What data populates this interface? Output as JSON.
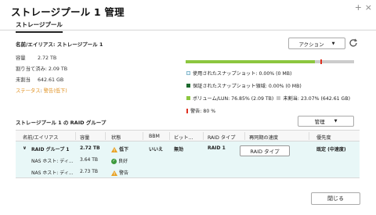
{
  "window": {
    "title": "ストレージプール 1 管理",
    "min_glyph": "+",
    "close_glyph": "×"
  },
  "tabs": [
    {
      "label": "ストレージプール"
    }
  ],
  "overview": {
    "name_line": "名前/エイリアス: ストレージプール 1",
    "rows": [
      {
        "label": "容量",
        "value": "2.72 TB"
      },
      {
        "label": "割り当て済み",
        "value": "2.09 TB"
      },
      {
        "label": "未割当",
        "value": "642.61 GB"
      },
      {
        "label": "ステータス",
        "value": "警告(低下)"
      }
    ],
    "status_color": "#e09020"
  },
  "actions": {
    "action_label": "アクション",
    "manage_label": "管理",
    "close_label": "閉じる",
    "raid_type_popup": "RAID タイプ"
  },
  "usage": {
    "used_fraction": 0.7685,
    "warn_fraction": 0.8,
    "legend": [
      {
        "key": "snapshot",
        "text": "使用されたスナップショット: 0.00% (0 MB)"
      },
      {
        "key": "reserved",
        "text": "保証されたスナップショット領域: 0.00% (0 MB)"
      },
      {
        "key": "volume",
        "text": "ボリューム/LUN: 76.85% (2.09 TB)"
      },
      {
        "key": "free",
        "text": "未割当: 23.07% (642.61 GB)"
      },
      {
        "key": "warning",
        "text": "警告: 80 %"
      }
    ],
    "colors": {
      "snapshot": "#e6f2ff",
      "reserved": "#1d6a2e",
      "volume": "#8cc63f",
      "free": "#c8c8c8",
      "warning": "#e03020"
    }
  },
  "raid_group": {
    "title": "ストレージプール 1 の RAID グループ",
    "columns": [
      "名前/エイリアス",
      "容量",
      "状態",
      "BBM",
      "ビット...",
      "RAID タイプ",
      "再同期の速度",
      "優先度"
    ],
    "rows": [
      {
        "name": "RAID グループ 1",
        "capacity": "2.72 TB",
        "status": "低下",
        "status_icon": "warning-icon",
        "bbm": "いいえ",
        "bitmap": "無効",
        "raid_type": "RAID 1",
        "resync": "",
        "priority": "既定 (中速度)"
      },
      {
        "name": "NAS ホスト: ディ...",
        "capacity": "3.64 TB",
        "status": "良好",
        "status_icon": "check-icon",
        "bbm": "",
        "bitmap": "",
        "raid_type": "",
        "resync": "",
        "priority": ""
      },
      {
        "name": "NAS ホスト: ディ...",
        "capacity": "2.73 TB",
        "status": "警告",
        "status_icon": "warning-icon",
        "bbm": "",
        "bitmap": "",
        "raid_type": "",
        "resync": "",
        "priority": ""
      }
    ]
  }
}
